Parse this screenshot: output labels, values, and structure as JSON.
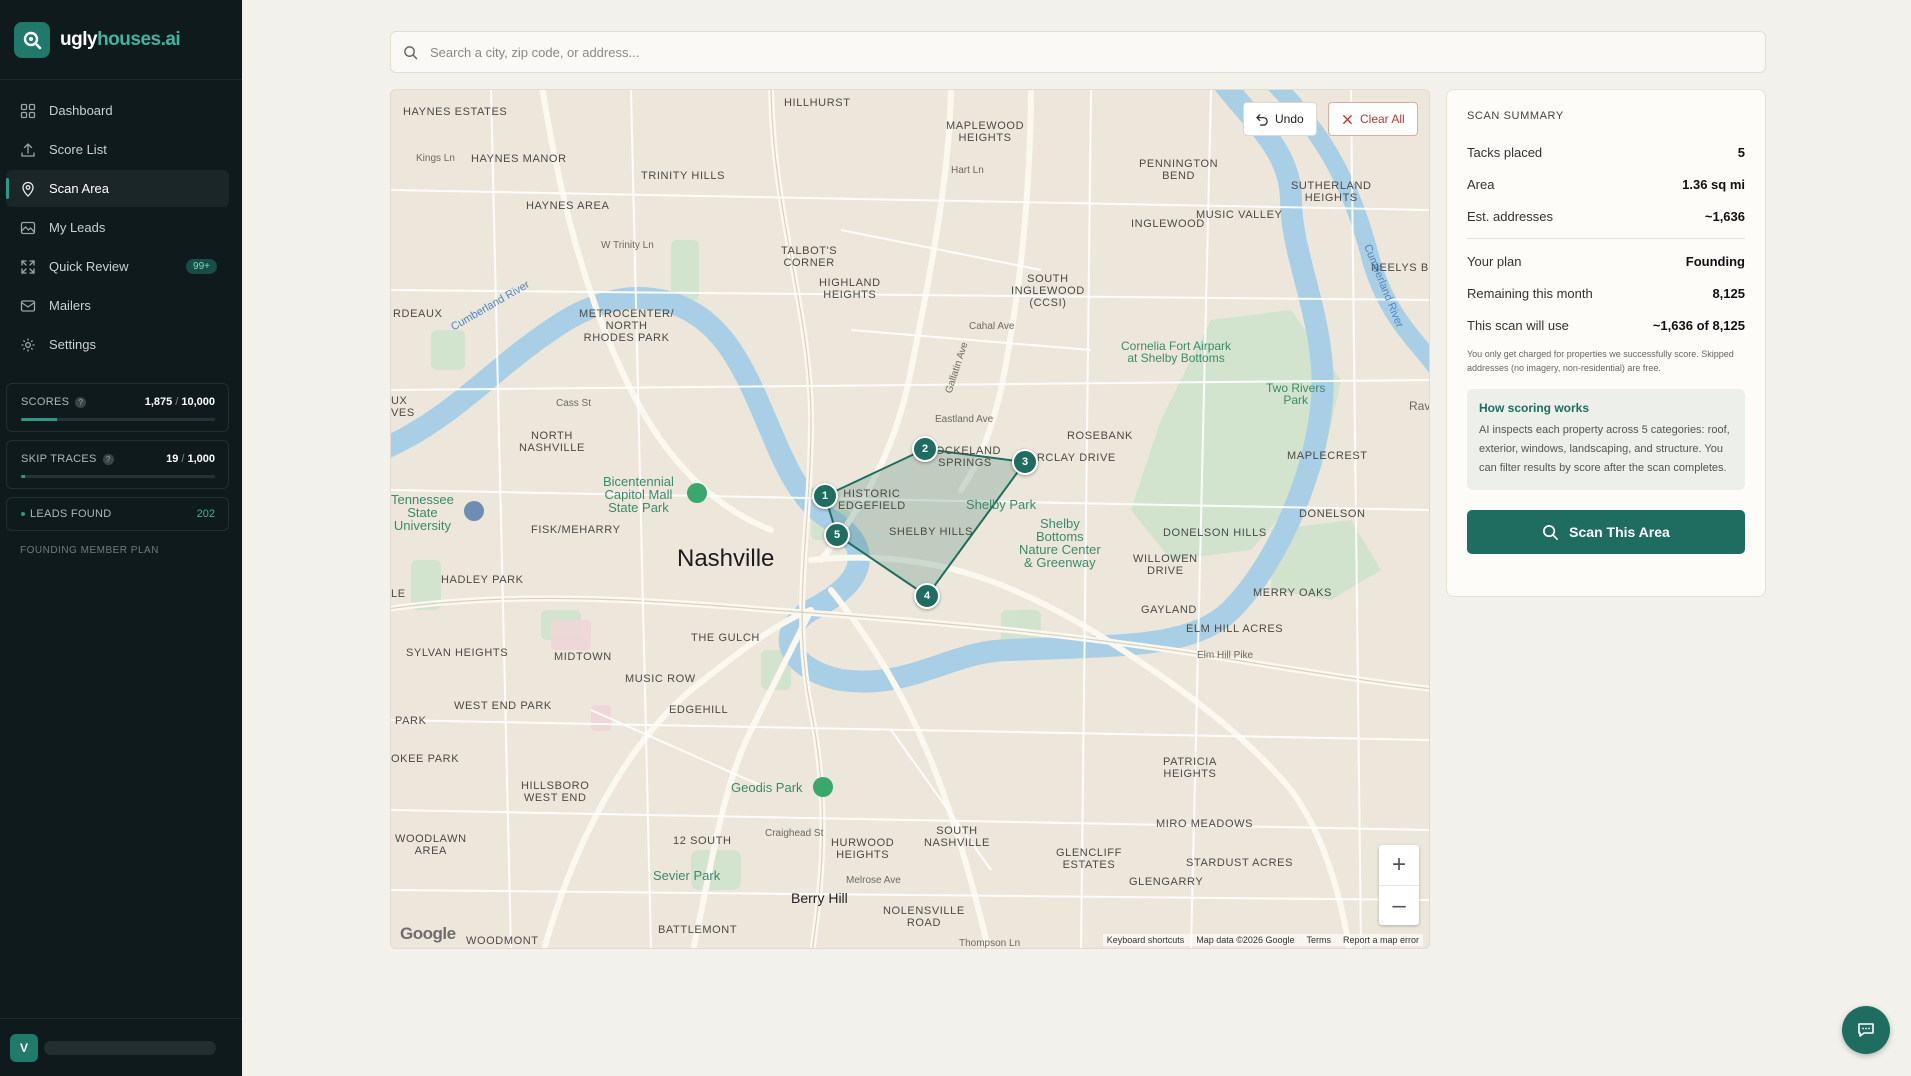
{
  "brand": {
    "name_part1": "ugly",
    "name_part2": "houses.ai"
  },
  "nav": [
    {
      "label": "Dashboard",
      "icon": "grid-icon"
    },
    {
      "label": "Score List",
      "icon": "upload-icon"
    },
    {
      "label": "Scan Area",
      "icon": "map-pin-icon",
      "active": true
    },
    {
      "label": "My Leads",
      "icon": "image-icon"
    },
    {
      "label": "Quick Review",
      "icon": "expand-icon",
      "badge": "99+"
    },
    {
      "label": "Mailers",
      "icon": "mail-icon"
    },
    {
      "label": "Settings",
      "icon": "gear-icon"
    }
  ],
  "stats": {
    "scores": {
      "label": "SCORES",
      "used": "1,875",
      "total": "10,000",
      "fraction": 0.1875
    },
    "skip_traces": {
      "label": "SKIP TRACES",
      "used": "19",
      "total": "1,000",
      "fraction": 0.019
    },
    "leads": {
      "label": "LEADS FOUND",
      "value": "202"
    }
  },
  "plan_label": "FOUNDING MEMBER PLAN",
  "user": {
    "initial": "V"
  },
  "search": {
    "placeholder": "Search a city, zip code, or address..."
  },
  "map": {
    "undo_label": "Undo",
    "clear_label": "Clear All",
    "zoom_in": "+",
    "zoom_out": "–",
    "footer": {
      "shortcuts": "Keyboard shortcuts",
      "data": "Map data ©2026 Google",
      "terms": "Terms",
      "report": "Report a map error"
    },
    "logo": "Google",
    "tacks": [
      "1",
      "2",
      "3",
      "4",
      "5"
    ],
    "labels": {
      "nashville": "Nashville",
      "berry_hill": "Berry Hill",
      "haynes_estates": "HAYNES ESTATES",
      "haynes_manor": "HAYNES MANOR",
      "haynes_area": "HAYNES AREA",
      "trinity_hills": "TRINITY HILLS",
      "hillhurst": "HILLHURST",
      "maplewood_heights": "MAPLEWOOD\nHEIGHTS",
      "pennington_bend": "PENNINGTON\nBEND",
      "sutherland_heights": "SUTHERLAND\nHEIGHTS",
      "music_valley": "MUSIC VALLEY",
      "inglewood": "INGLEWOOD",
      "neelys_b": "NEELYS B",
      "talbots_corner": "TALBOT'S\nCORNER",
      "highland_heights": "HIGHLAND\nHEIGHTS",
      "south_inglewood": "SOUTH\nINGLEWOOD\n(CCSI)",
      "rdeaux": "RDEAUX",
      "metrocenter": "METROCENTER/\nNORTH\nRHODES PARK",
      "cornelia_fort": "Cornelia Fort Airpark\nat Shelby Bottoms",
      "two_rivers": "Two Rivers\nPark",
      "rav": "Rav",
      "rosebank": "ROSEBANK",
      "maplecrest": "MAPLECREST",
      "lockeland": "LOCKELAND\nSPRINGS",
      "barclay": "BARCLAY DRIVE",
      "historic_edgefield": "HISTORIC\nEDGEFIELD",
      "shelby_park": "Shelby Park",
      "shelby_hills": "SHELBY HILLS",
      "north_nashville": "NORTH\nNASHVILLE",
      "bicentennial": "Bicentennial\nCapitol Mall\nState Park",
      "tennessee_state": "Tennessee\nState\nUniversity",
      "fisk": "FISK/MEHARRY",
      "shelby_bottoms": "Shelby\nBottoms\nNature Center\n& Greenway",
      "donelson_hills": "DONELSON HILLS",
      "donelson": "DONELSON",
      "willowen": "WILLOWEN\nDRIVE",
      "hadley_park": "HADLEY PARK",
      "gayland": "GAYLAND",
      "merry_oaks": "MERRY OAKS",
      "elm_hill": "ELM HILL ACRES",
      "the_gulch": "THE GULCH",
      "sylvan_heights": "SYLVAN HEIGHTS",
      "midtown": "MIDTOWN",
      "music_row": "MUSIC ROW",
      "west_end_park": "WEST END PARK",
      "edgehill": "EDGEHILL",
      "park": "PARK",
      "okee_park": "OKEE PARK",
      "hillsboro": "HILLSBORO\nWEST END",
      "geodis": "Geodis Park",
      "patricia": "PATRICIA\nHEIGHTS",
      "miro_meadows": "MIRO MEADOWS",
      "south_nashville": "SOUTH\nNASHVILLE",
      "glencliff": "GLENCLIFF\nESTATES",
      "stardust": "STARDUST ACRES",
      "glengarry": "GLENGARRY",
      "woodlawn": "WOODLAWN\nAREA",
      "twelve_south": "12 SOUTH",
      "hurwood": "HURWOOD\nHEIGHTS",
      "sevier_park": "Sevier Park",
      "nolensville": "NOLENSVILLE\nROAD",
      "battlemont": "BATTLEMONT",
      "woodmont": "WOODMONT",
      "cumberland_river": "Cumberland River",
      "cumberland_river_e": "Cumberland River",
      "kings_ln": "Kings Ln",
      "w_trinity": "W Trinity Ln",
      "cass_st": "Cass St",
      "eastland": "Eastland Ave",
      "cahal": "Cahal Ave",
      "gallatin": "Gallatin Ave",
      "elm_hill_pike": "Elm Hill Pike",
      "craighead": "Craighead St",
      "melrose": "Melrose Ave",
      "thompson": "Thompson Ln",
      "ux_ves": "UX\nVES",
      "le": "LE",
      "hart_ln": "Hart Ln"
    }
  },
  "summary": {
    "title": "SCAN SUMMARY",
    "rows_top": [
      {
        "label": "Tacks placed",
        "value": "5"
      },
      {
        "label": "Area",
        "value": "1.36 sq mi"
      },
      {
        "label": "Est. addresses",
        "value": "~1,636"
      }
    ],
    "rows_bottom": [
      {
        "label": "Your plan",
        "value": "Founding"
      },
      {
        "label": "Remaining this month",
        "value": "8,125"
      },
      {
        "label": "This scan will use",
        "value": "~1,636 of 8,125"
      }
    ],
    "note": "You only get charged for properties we successfully score. Skipped addresses (no imagery, non-residential) are free.",
    "how_title": "How scoring works",
    "how_text": "AI inspects each property across 5 categories: roof, exterior, windows, landscaping, and structure. You can filter results by score after the scan completes.",
    "scan_button": "Scan This Area"
  },
  "colors": {
    "accent": "#1f6d61",
    "sidebar": "#0f1a1d",
    "danger": "#c0392b"
  }
}
